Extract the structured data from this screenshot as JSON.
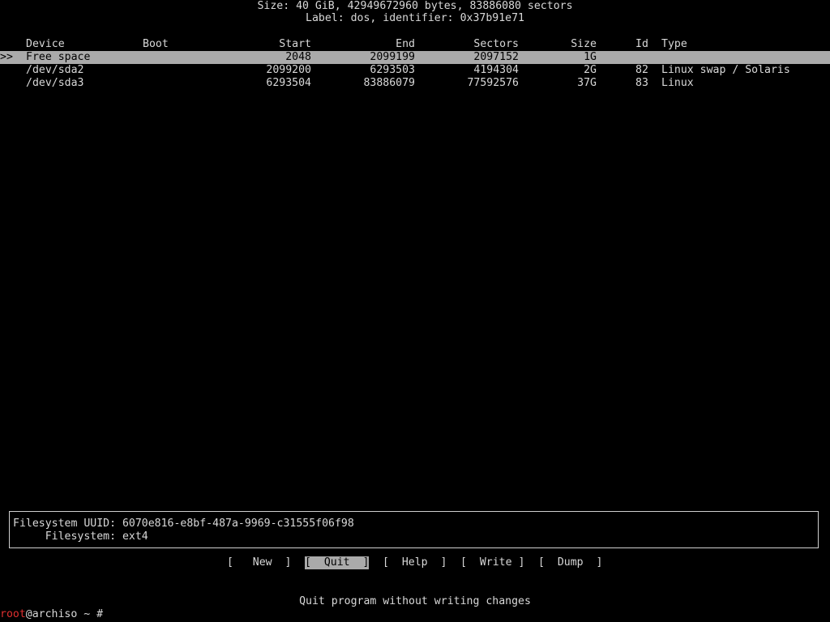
{
  "header": {
    "size_line": "Size: 40 GiB, 42949672960 bytes, 83886080 sectors",
    "label_line": "Label: dos, identifier: 0x37b91e71"
  },
  "table": {
    "columns": {
      "device": "Device",
      "boot": "Boot",
      "start": "Start",
      "end": "End",
      "sectors": "Sectors",
      "size": "Size",
      "id": "Id",
      "type": "Type"
    },
    "selected_marker": ">>",
    "rows": [
      {
        "device": "Free space",
        "boot": "",
        "start": "2048",
        "end": "2099199",
        "sectors": "2097152",
        "size": "1G",
        "id": "",
        "type": "",
        "selected": true
      },
      {
        "device": "/dev/sda2",
        "boot": "",
        "start": "2099200",
        "end": "6293503",
        "sectors": "4194304",
        "size": "2G",
        "id": "82",
        "type": "Linux swap / Solaris",
        "selected": false
      },
      {
        "device": "/dev/sda3",
        "boot": "",
        "start": "6293504",
        "end": "83886079",
        "sectors": "77592576",
        "size": "37G",
        "id": "83",
        "type": "Linux",
        "selected": false
      }
    ]
  },
  "info": {
    "line1": "Filesystem UUID: 6070e816-e8bf-487a-9969-c31555f06f98",
    "line2": "     Filesystem: ext4"
  },
  "menu": {
    "new": "[   New  ]",
    "quit": "[  Quit  ]",
    "help": "[  Help  ]",
    "write": "[  Write ]",
    "dump": "[  Dump  ]",
    "active": "quit"
  },
  "status_line": "Quit program without writing changes",
  "prompt": {
    "user_host": "root",
    "rest": "@archiso ~ #"
  },
  "colors": {
    "background": "#000000",
    "foreground": "#d8d8d8",
    "highlight_bg": "#aaaaaa",
    "prompt_user": "#e03030"
  }
}
